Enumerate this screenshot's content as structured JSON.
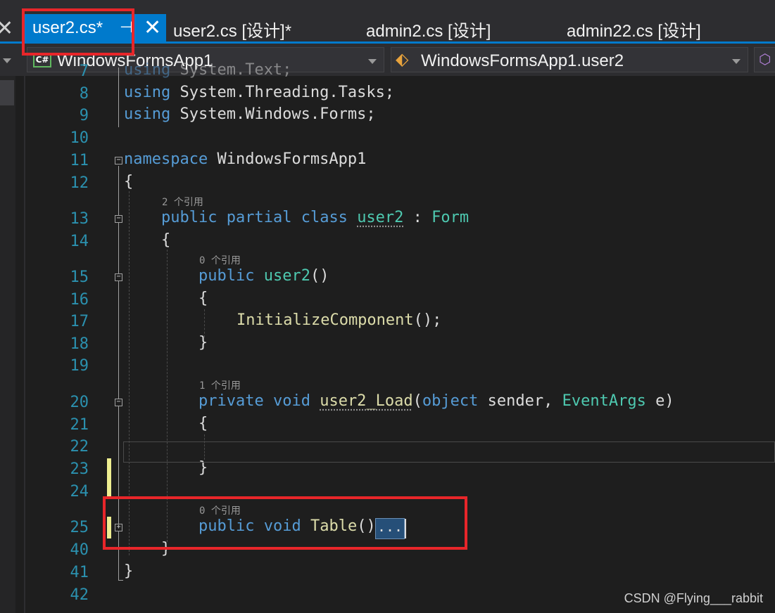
{
  "tabs": [
    {
      "label": "user2.cs*",
      "active": true
    },
    {
      "label": "user2.cs [设计]*",
      "active": false
    },
    {
      "label": "admin2.cs [设计]",
      "active": false
    },
    {
      "label": "admin22.cs [设计]",
      "active": false
    }
  ],
  "tab_icons": {
    "pin": "pin-icon",
    "close": "close-icon",
    "overflow_close": "close-icon"
  },
  "navbar": {
    "project": "WindowsFormsApp1",
    "project_icon": "csharp-icon",
    "class": "WindowsFormsApp1.user2",
    "class_icon": "class-icon",
    "member_icon": "member-cube-icon"
  },
  "code_lines": [
    {
      "num": "7",
      "text": "using System.Text;"
    },
    {
      "num": "8",
      "text": "using System.Threading.Tasks;"
    },
    {
      "num": "9",
      "text": "using System.Windows.Forms;"
    },
    {
      "num": "10",
      "text": ""
    },
    {
      "num": "11",
      "text": "namespace WindowsFormsApp1"
    },
    {
      "num": "12",
      "text": "{"
    },
    {
      "num": "13",
      "text": "public partial class user2 : Form"
    },
    {
      "num": "14",
      "text": "{"
    },
    {
      "num": "15",
      "text": "public user2()"
    },
    {
      "num": "16",
      "text": "{"
    },
    {
      "num": "17",
      "text": "InitializeComponent();"
    },
    {
      "num": "18",
      "text": "}"
    },
    {
      "num": "19",
      "text": ""
    },
    {
      "num": "20",
      "text": "private void user2_Load(object sender, EventArgs e)"
    },
    {
      "num": "21",
      "text": "{"
    },
    {
      "num": "22",
      "text": ""
    },
    {
      "num": "23",
      "text": "}"
    },
    {
      "num": "24",
      "text": ""
    },
    {
      "num": "25",
      "text": "public void Table()"
    },
    {
      "num": "40",
      "text": "}"
    },
    {
      "num": "41",
      "text": "}"
    },
    {
      "num": "42",
      "text": ""
    }
  ],
  "codelens": {
    "class_refs": "2 个引用",
    "ctor_refs": "0 个引用",
    "load_refs": "1 个引用",
    "table_refs": "0 个引用"
  },
  "tokens": {
    "using": "using",
    "ns_text": "System.Text;",
    "ns_threading": "System.Threading.Tasks;",
    "ns_forms": "System.Windows.Forms;",
    "namespace_kw": "namespace",
    "namespace_name": "WindowsFormsApp1",
    "public": "public",
    "partial": "partial",
    "class": "class",
    "private": "private",
    "void": "void",
    "object": "object",
    "class_name": "user2",
    "colon": " : ",
    "base": "Form",
    "ctor": "user2",
    "parens": "()",
    "init_call": "InitializeComponent",
    "init_tail": "();",
    "load_name": "user2_Load",
    "open_paren": "(",
    "sender": " sender, ",
    "eventargs": "EventArgs",
    "e_close": " e)",
    "table_name": "Table",
    "collapsed": "...",
    "open_brace": "{",
    "close_brace": "}"
  },
  "watermark": "CSDN @Flying___rabbit",
  "colors": {
    "accent": "#007acc",
    "keyword": "#569cd6",
    "type": "#4ec9b0",
    "method": "#dcdcaa",
    "line_number": "#2b91af",
    "annotation_red": "#e8262a",
    "change_bar": "#efef91"
  }
}
